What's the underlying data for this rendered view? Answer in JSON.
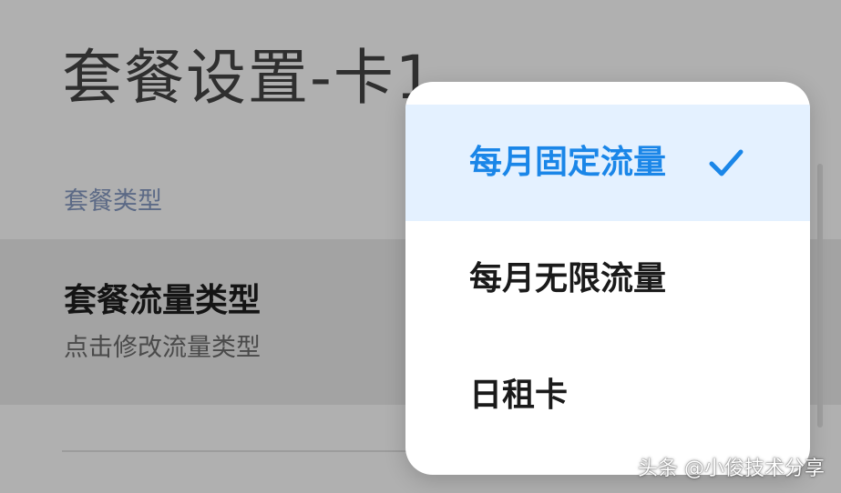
{
  "header": {
    "title": "套餐设置-卡1"
  },
  "section": {
    "label": "套餐类型"
  },
  "setting_row": {
    "title": "套餐流量类型",
    "subtitle": "点击修改流量类型"
  },
  "popup": {
    "options": [
      {
        "label": "每月固定流量",
        "selected": true
      },
      {
        "label": "每月无限流量",
        "selected": false
      },
      {
        "label": "日租卡",
        "selected": false
      }
    ],
    "selected_icon": "checkmark-icon"
  },
  "watermark": {
    "text": "头条 @小俊技术分享"
  },
  "colors": {
    "accent": "#1a86e8",
    "selected_background": "#e4f1ff",
    "scrim_background": "#b0b0b0"
  }
}
